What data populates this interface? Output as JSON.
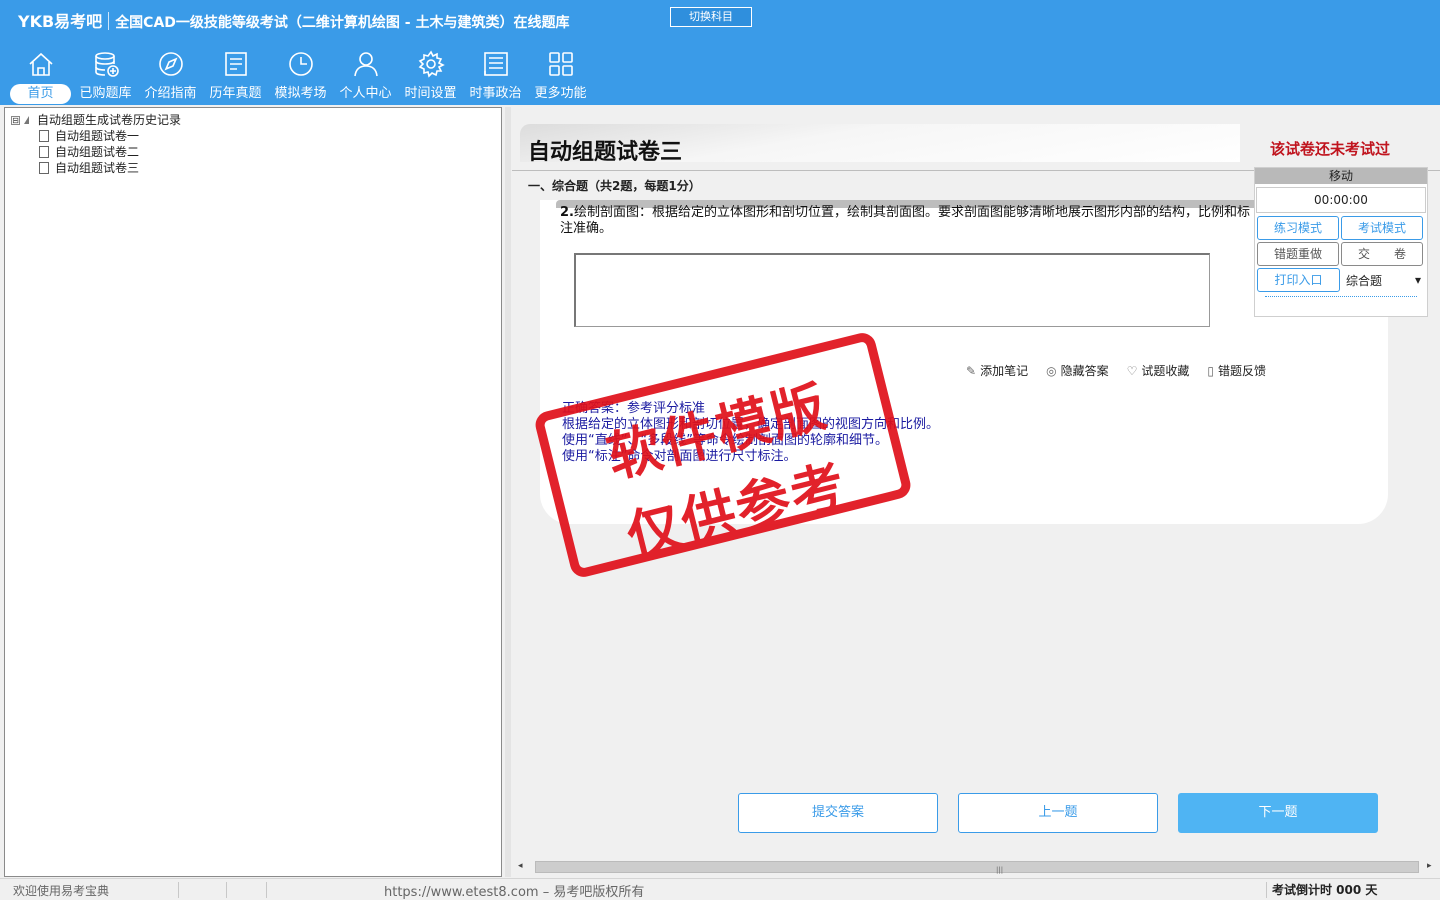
{
  "header": {
    "brand": "YKB易考吧",
    "title": "全国CAD一级技能等级考试（二维计算机绘图 - 土木与建筑类）在线题库",
    "switch_label": "切换科目"
  },
  "nav": [
    {
      "label": "首页",
      "icon": "home-icon"
    },
    {
      "label": "已购题库",
      "icon": "database-icon"
    },
    {
      "label": "介绍指南",
      "icon": "compass-icon"
    },
    {
      "label": "历年真题",
      "icon": "list-icon"
    },
    {
      "label": "模拟考场",
      "icon": "clock-icon"
    },
    {
      "label": "个人中心",
      "icon": "user-icon"
    },
    {
      "label": "时间设置",
      "icon": "gear-icon"
    },
    {
      "label": "时事政治",
      "icon": "news-icon"
    },
    {
      "label": "更多功能",
      "icon": "grid-icon"
    }
  ],
  "tree": {
    "root": "自动组题生成试卷历史记录",
    "toggle": "⊟",
    "items": [
      "自动组题试卷一",
      "自动组题试卷二",
      "自动组题试卷三"
    ]
  },
  "paper": {
    "title": "自动组题试卷三",
    "status": "该试卷还未考试过",
    "section": "一、综合题（共2题，每题1分）"
  },
  "question": {
    "number": "2.",
    "text": "绘制剖面图：根据给定的立体图形和剖切位置，绘制其剖面图。要求剖面图能够清晰地展示图形内部的结构，比例和标注准确。"
  },
  "actions": [
    {
      "label": "添加笔记",
      "icon": "pencil-icon",
      "glyph": "✎"
    },
    {
      "label": "隐藏答案",
      "icon": "eye-icon",
      "glyph": "◎"
    },
    {
      "label": "试题收藏",
      "icon": "heart-icon",
      "glyph": "♡"
    },
    {
      "label": "错题反馈",
      "icon": "feedback-icon",
      "glyph": "▯"
    }
  ],
  "answer": {
    "lines": [
      "正确答案：参考评分标准",
      "根据给定的立体图形和剖切位置，确定剖面图的视图方向和比例。",
      "使用“直线”、“多段线”等命令绘制剖面图的轮廓和细节。",
      "使用“标注”命令对剖面图进行尺寸标注。"
    ]
  },
  "watermark": {
    "line1": "软件模版",
    "line2": "仅供参考"
  },
  "control": {
    "move": "移动",
    "timer": "00:00:00",
    "practice_mode": "练习模式",
    "exam_mode": "考试模式",
    "redo_wrong": "错题重做",
    "submit_paper": "交　　卷",
    "print": "打印入口",
    "type_select": "综合题"
  },
  "bottom": {
    "submit": "提交答案",
    "prev": "上一题",
    "next": "下一题"
  },
  "status": {
    "welcome": "欢迎使用易考宝典",
    "copyright": "https://www.etest8.com – 易考吧版权所有",
    "countdown": "考试倒计时 000 天"
  },
  "colors": {
    "accent": "#3a9be8",
    "alert": "#c0141e",
    "answer": "#1a1aa0",
    "stamp": "#e0101a"
  }
}
